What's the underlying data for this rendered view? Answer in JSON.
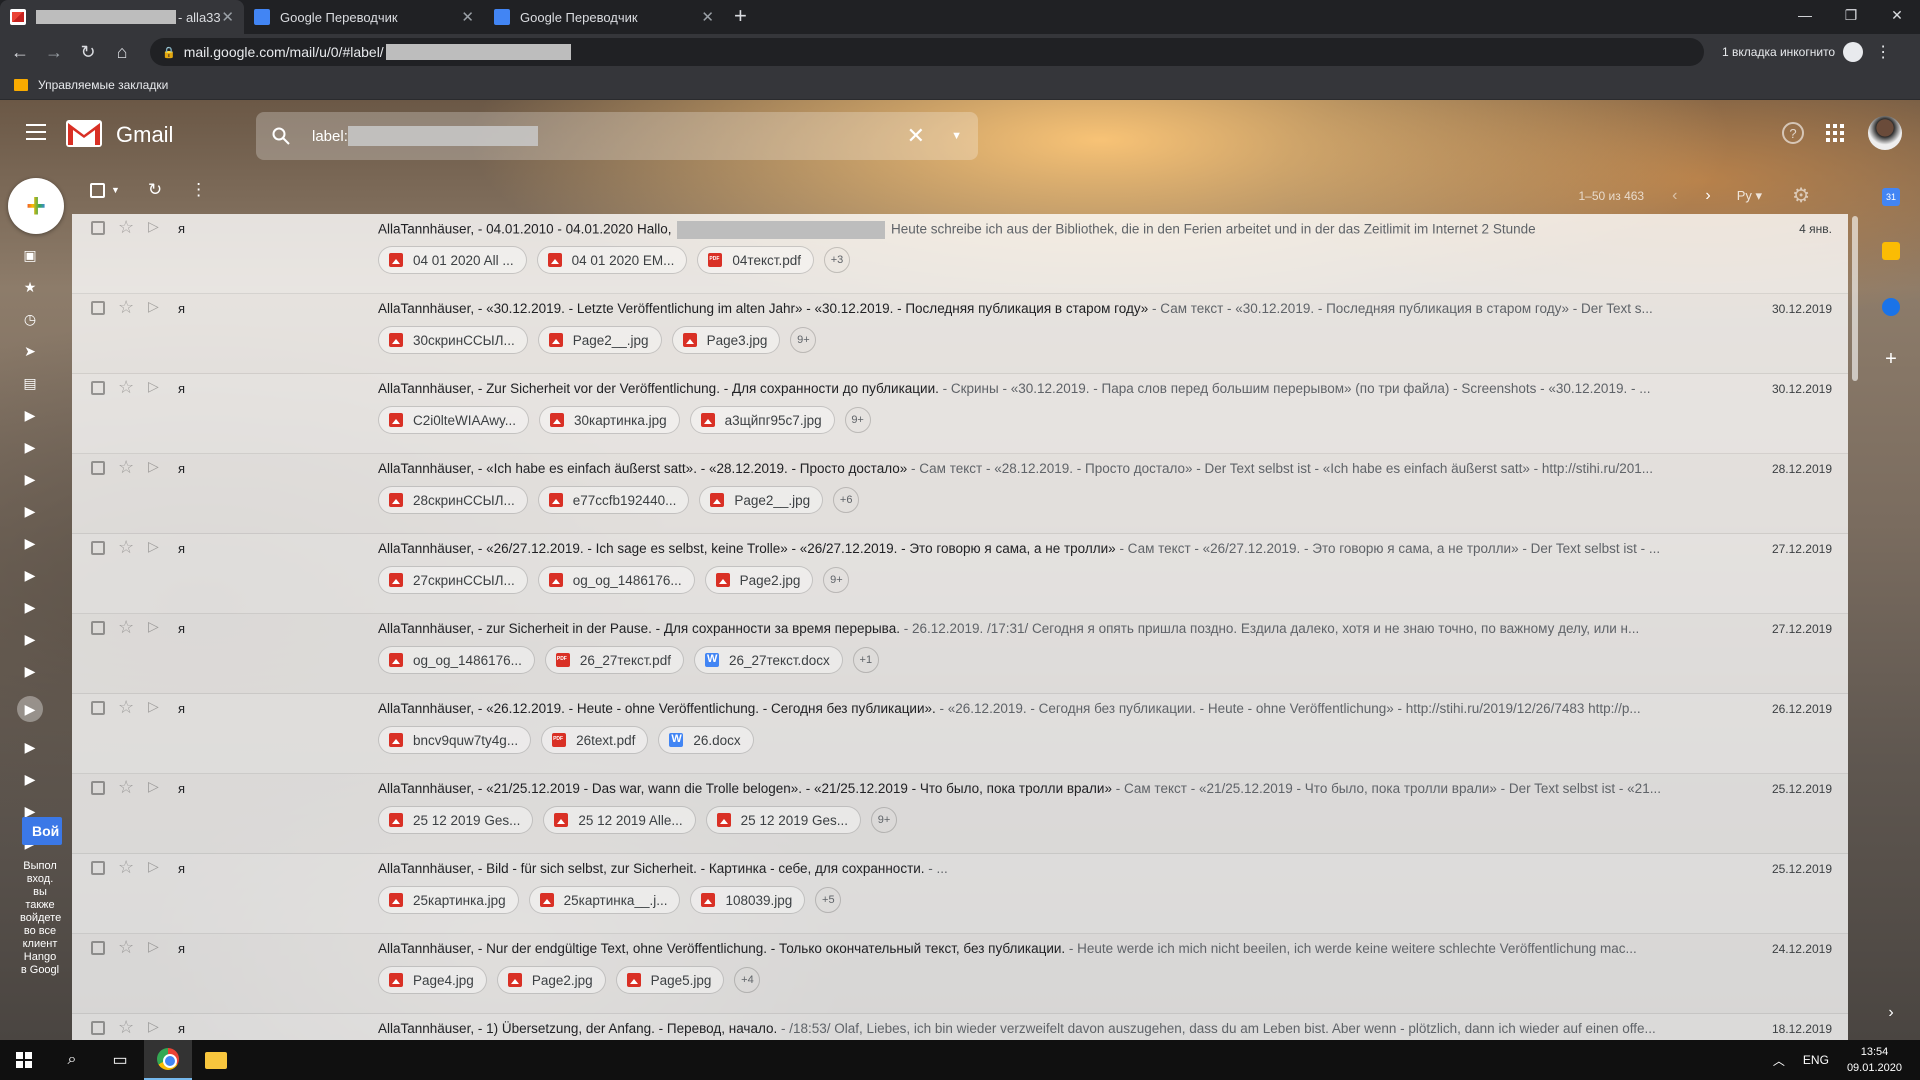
{
  "browser": {
    "tabs": [
      {
        "title": "- alla33",
        "active": true
      },
      {
        "title": "Google Переводчик",
        "active": false
      },
      {
        "title": "Google Переводчик",
        "active": false
      }
    ],
    "url": "mail.google.com/mail/u/0/#label/",
    "incognito_label": "1 вкладка инкогнито",
    "bookmark_folder": "Управляемые закладки"
  },
  "gmail": {
    "logo_text": "Gmail",
    "search_prefix": "label:",
    "pager_text": "1–50 из 463",
    "lang_label": "Ру",
    "hangouts_button": "Вой",
    "hangouts_text": "Выпол вход. вы также войдете во все клиент Hango в Googl"
  },
  "emails": [
    {
      "sender": "я",
      "subject": "AllaTannhäuser, - 04.01.2010 - 04.01.2020 Hallo,",
      "redacted": true,
      "snippet": "Heute schreibe ich aus der Bibliothek, die in den Ferien arbeitet und in der das Zeitlimit im Internet 2 Stunde",
      "date": "4 янв.",
      "attachments": [
        {
          "name": "04 01 2020 All ...",
          "type": "img"
        },
        {
          "name": "04 01 2020 EM...",
          "type": "img"
        },
        {
          "name": "04текст.pdf",
          "type": "pdf"
        }
      ],
      "more": "+3"
    },
    {
      "sender": "я",
      "subject": "AllaTannhäuser, - «30.12.2019. - Letzte Veröffentlichung im alten Jahr» - «30.12.2019. - Последняя публикация в старом году»",
      "redacted": false,
      "snippet": " - Сам текст - «30.12.2019. - Последняя публикация в старом году» - Der Text s...",
      "date": "30.12.2019",
      "attachments": [
        {
          "name": "30скринССЫЛ...",
          "type": "img"
        },
        {
          "name": "Page2__.jpg",
          "type": "img"
        },
        {
          "name": "Page3.jpg",
          "type": "img"
        }
      ],
      "more": "9+"
    },
    {
      "sender": "я",
      "subject": "AllaTannhäuser, - Zur Sicherheit vor der Veröffentlichung. - Для сохранности до публикации.",
      "redacted": false,
      "snippet": " - Скрины - «30.12.2019. - Пара слов перед большим перерывом» (по три файла) - Screenshots - «30.12.2019. - ...",
      "date": "30.12.2019",
      "attachments": [
        {
          "name": "C2i0lteWIAAwy...",
          "type": "img"
        },
        {
          "name": "30картинка.jpg",
          "type": "img"
        },
        {
          "name": "а3щйпг95с7.jpg",
          "type": "img"
        }
      ],
      "more": "9+"
    },
    {
      "sender": "я",
      "subject": "AllaTannhäuser, - «Ich habe es einfach äußerst satt». - «28.12.2019. - Просто достало»",
      "redacted": false,
      "snippet": " - Сам текст - «28.12.2019. - Просто достало» - Der Text selbst ist - «Ich habe es einfach äußerst satt» - http://stihi.ru/201...",
      "date": "28.12.2019",
      "attachments": [
        {
          "name": "28скринССЫЛ...",
          "type": "img"
        },
        {
          "name": "e77ccfb192440...",
          "type": "img"
        },
        {
          "name": "Page2__.jpg",
          "type": "img"
        }
      ],
      "more": "+6"
    },
    {
      "sender": "я",
      "subject": "AllaTannhäuser, - «26/27.12.2019. - Ich sage es selbst, keine Trolle» - «26/27.12.2019. - Это говорю я сама, а не тролли»",
      "redacted": false,
      "snippet": " - Сам текст - «26/27.12.2019. - Это говорю я сама, а не тролли» - Der Text selbst ist - ...",
      "date": "27.12.2019",
      "attachments": [
        {
          "name": "27скринССЫЛ...",
          "type": "img"
        },
        {
          "name": "og_og_1486176...",
          "type": "img"
        },
        {
          "name": "Page2.jpg",
          "type": "img"
        }
      ],
      "more": "9+"
    },
    {
      "sender": "я",
      "subject": "AllaTannhäuser, - zur Sicherheit in der Pause. - Для сохранности за время перерыва.",
      "redacted": false,
      "snippet": " - 26.12.2019. /17:31/ Сегодня я опять пришла поздно. Ездила далеко, хотя и не знаю точно, по важному делу, или н...",
      "date": "27.12.2019",
      "attachments": [
        {
          "name": "og_og_1486176...",
          "type": "img"
        },
        {
          "name": "26_27текст.pdf",
          "type": "pdf"
        },
        {
          "name": "26_27текст.docx",
          "type": "doc"
        }
      ],
      "more": "+1"
    },
    {
      "sender": "я",
      "subject": "AllaTannhäuser, - «26.12.2019. - Heute - ohne Veröffentlichung. - Сегодня без публикации».",
      "redacted": false,
      "snippet": " - «26.12.2019. - Сегодня без публикации. - Heute - ohne Veröffentlichung» - http://stihi.ru/2019/12/26/7483 http://p...",
      "date": "26.12.2019",
      "attachments": [
        {
          "name": "bncv9quw7ty4g...",
          "type": "img"
        },
        {
          "name": "26text.pdf",
          "type": "pdf"
        },
        {
          "name": "26.docx",
          "type": "doc"
        }
      ],
      "more": ""
    },
    {
      "sender": "я",
      "subject": "AllaTannhäuser, - «21/25.12.2019 - Das war, wann die Trolle belogen». - «21/25.12.2019 - Что было, пока тролли врали»",
      "redacted": false,
      "snippet": " - Сам текст - «21/25.12.2019 - Что было, пока тролли врали» - Der Text selbst ist - «21...",
      "date": "25.12.2019",
      "attachments": [
        {
          "name": "25 12 2019 Ges...",
          "type": "img"
        },
        {
          "name": "25 12 2019 Alle...",
          "type": "img"
        },
        {
          "name": "25 12 2019 Ges...",
          "type": "img"
        }
      ],
      "more": "9+"
    },
    {
      "sender": "я",
      "subject": "AllaTannhäuser, - Bild - für sich selbst, zur Sicherheit. - Картинка - себе, для сохранности.",
      "redacted": false,
      "snippet": " - ...",
      "date": "25.12.2019",
      "attachments": [
        {
          "name": "25картинка.jpg",
          "type": "img"
        },
        {
          "name": "25картинка__.j...",
          "type": "img"
        },
        {
          "name": "108039.jpg",
          "type": "img"
        }
      ],
      "more": "+5"
    },
    {
      "sender": "я",
      "subject": "AllaTannhäuser, - Nur der endgültige Text, ohne Veröffentlichung. - Только окончательный текст, без публикации.",
      "redacted": false,
      "snippet": " - Heute werde ich mich nicht beeilen, ich werde keine weitere schlechte Veröffentlichung mac...",
      "date": "24.12.2019",
      "attachments": [
        {
          "name": "Page4.jpg",
          "type": "img"
        },
        {
          "name": "Page2.jpg",
          "type": "img"
        },
        {
          "name": "Page5.jpg",
          "type": "img"
        }
      ],
      "more": "+4"
    },
    {
      "sender": "я",
      "subject": "AllaTannhäuser, - 1) Übersetzung, der Anfang. - Перевод, начало.",
      "redacted": false,
      "snippet": " - /18:53/ Olaf, Liebes, ich bin wieder verzweifelt davon auszugehen, dass du am Leben bist. Aber wenn - plötzlich, dann ich wieder auf einen offe...",
      "date": "18.12.2019",
      "attachments": [],
      "more": ""
    }
  ],
  "taskbar": {
    "lang": "ENG",
    "time": "13:54",
    "date": "09.01.2020"
  }
}
